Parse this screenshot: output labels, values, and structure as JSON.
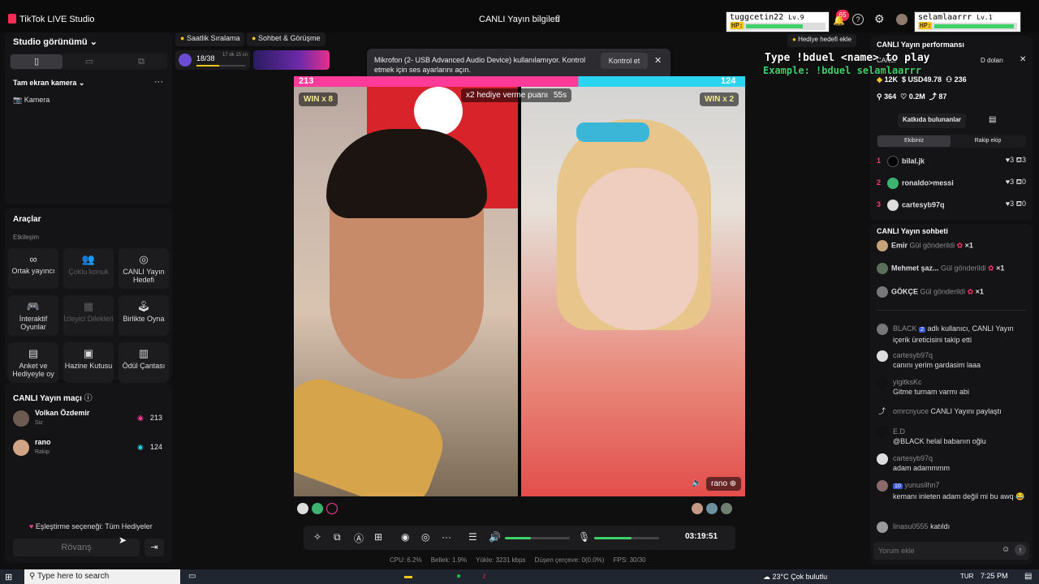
{
  "window": {
    "app_title": "TikTok LIVE Studio",
    "center_title": "CANLI Yayın bilgileri"
  },
  "overlay": {
    "user_left": {
      "name": "tuggcetin22",
      "level": "Lv.9",
      "hp": "HP:"
    },
    "user_right": {
      "name": "selamlaarrr",
      "level": "Lv.1",
      "hp": "HP:"
    },
    "notif_count": "65",
    "duel_line1": "Type !bduel <name> to play",
    "duel_line2": "Example: !bduel selamlaarrr"
  },
  "left": {
    "studio_view": "Studio görünümü",
    "camera_section": "Tam ekran kamera",
    "camera_item": "Kamera",
    "tools_title": "Araçlar",
    "interaction": "Etkileşim",
    "tools": [
      {
        "label": "Ortak yayıncı",
        "icon": "link-icon"
      },
      {
        "label": "Çoklu konuk",
        "icon": "users-icon"
      },
      {
        "label": "CANLI Yayın Hedefi",
        "icon": "target-icon"
      },
      {
        "label": "İnteraktif Oyunlar",
        "icon": "gamepad-icon"
      },
      {
        "label": "İzleyici Dilekleri",
        "icon": "gift-icon"
      },
      {
        "label": "Birlikte Oyna",
        "icon": "joystick-icon"
      },
      {
        "label": "Anket ve Hediyeyle oy",
        "icon": "poll-icon"
      },
      {
        "label": "Hazine Kutusu",
        "icon": "box-icon"
      },
      {
        "label": "Ödül Çantası",
        "icon": "bag-icon"
      }
    ],
    "match_title": "CANLI Yayın maçı",
    "players": [
      {
        "name": "Volkan Özdemir",
        "role": "Siz",
        "score": "213"
      },
      {
        "name": "rano",
        "role": "Rakip",
        "score": "124"
      }
    ],
    "match_option": "Eşleştirme seçeneği: Tüm Hediyeler",
    "rematch": "Rövanş"
  },
  "toolbar_top": {
    "hourly": "Saatlik Sıralama",
    "chat": "Sohbet & Görüşme",
    "progress": "18/38",
    "time_left": "17 dk 15 sn"
  },
  "mic_banner": {
    "text": "Mikrofon (2- USB Advanced Audio Device) kullanılamıyor. Kontrol etmek için ses ayarlarını açın.",
    "button": "Kontrol et"
  },
  "battle": {
    "left_score": "213",
    "right_score": "124",
    "left_win": "WIN x 8",
    "right_win": "WIN x 2",
    "gift_points": "x2 hediye verme puanı",
    "timer": "55s",
    "right_name": "rano",
    "score_fraction": 0.63
  },
  "controls": {
    "elapsed": "03:19:51"
  },
  "stats": {
    "cpu": "CPU: 6.2%",
    "memory": "Bellek: 1.9%",
    "upload": "Yükle: 3231 kbps",
    "dropped": "Düşen çerçeve: 0(0.0%)",
    "fps": "FPS: 30/30"
  },
  "right": {
    "goal_btn": "Hediye hedefi ekle",
    "perf_title": "CANLI Yayın performansı",
    "perf_sub": "CANLI",
    "usd_label": "D doları",
    "metrics": {
      "likes": "12K",
      "usd": "USD49.78",
      "viewers": "236",
      "people": "364",
      "hearts": "0.2M",
      "shares": "87"
    },
    "contributors": "Katkıda bulunanlar",
    "tab_team": "Ekibiniz",
    "tab_rival": "Rakip ekip",
    "ranking": [
      {
        "rank": "1",
        "name": "bilal.jk",
        "likes": "3",
        "gifts": "3"
      },
      {
        "rank": "2",
        "name": "ronaldo>messi",
        "likes": "3",
        "gifts": "0"
      },
      {
        "rank": "3",
        "name": "cartesyb97q",
        "likes": "3",
        "gifts": "0"
      }
    ],
    "chat_title": "CANLI Yayın sohbeti",
    "gifts": [
      {
        "name": "Emir",
        "text": "Gül gönderildi",
        "count": "×1"
      },
      {
        "name": "Mehmet şaz...",
        "text": "Gül gönderildi",
        "count": "×1"
      },
      {
        "name": "GÖKÇE",
        "text": "Gül gönderildi",
        "count": "×1"
      }
    ],
    "messages": [
      {
        "user": "BLACK",
        "badge": "2",
        "text": "adlı kullanıcı, CANLI Yayın içerik üreticisini takip etti"
      },
      {
        "user": "cartesyb97q",
        "text": "canını yerim gardasim laaa"
      },
      {
        "user": "yigitksKc",
        "text": "Gitme turnam varmı abi"
      },
      {
        "user": "omrcnyuce",
        "text": "CANLI Yayını paylaştı"
      },
      {
        "user": "E.D",
        "text": "@BLACK helal babanın oğlu"
      },
      {
        "user": "cartesyb97q",
        "text": "adam adammmm"
      },
      {
        "user": "yunusllhn7",
        "badge": "10",
        "text": "kemanı inleten adam değil mi bu awq 😂"
      },
      {
        "user": "linasu0555",
        "text": "katıldı"
      }
    ],
    "comment_placeholder": "Yorum ekle"
  },
  "taskbar": {
    "search": "Type here to search",
    "weather": "23°C  Çok bulutlu",
    "lang": "TUR",
    "time": "7:25 PM"
  },
  "colors": {
    "accent_pink": "#ff3b9a",
    "accent_cyan": "#2bd4f0",
    "brand": "#fe2c55"
  }
}
